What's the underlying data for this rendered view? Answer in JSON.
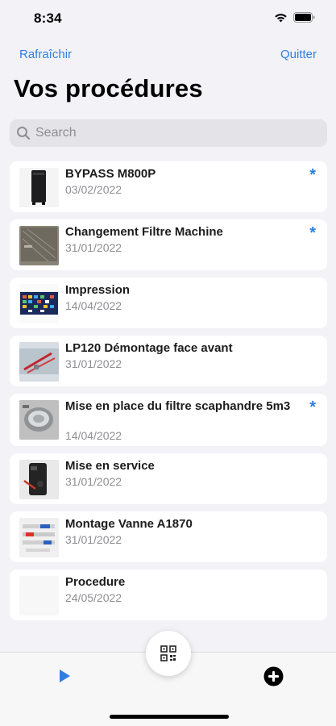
{
  "status_bar": {
    "time": "8:34"
  },
  "nav": {
    "left_label": "Rafraîchir",
    "right_label": "Quitter"
  },
  "title": "Vos procédures",
  "search": {
    "placeholder": "Search"
  },
  "procedures": [
    {
      "title": "BYPASS M800P",
      "date": "03/02/2022",
      "starred": true
    },
    {
      "title": "Changement Filtre Machine",
      "date": "31/01/2022",
      "starred": true
    },
    {
      "title": "Impression",
      "date": "14/04/2022",
      "starred": false
    },
    {
      "title": "LP120 Démontage face avant",
      "date": "31/01/2022",
      "starred": false
    },
    {
      "title": "Mise en place du filtre scaphandre 5m3",
      "date": "14/04/2022",
      "starred": true
    },
    {
      "title": "Mise en service",
      "date": "31/01/2022",
      "starred": false
    },
    {
      "title": "Montage Vanne A1870",
      "date": "31/01/2022",
      "starred": false
    },
    {
      "title": "Procedure",
      "date": "24/05/2022",
      "starred": false
    }
  ],
  "star_glyph": "*",
  "colors": {
    "accent": "#2f7fe0",
    "background": "#f2f2f7"
  },
  "tabbar": {
    "left_icon": "play-icon",
    "center_icon": "qr-code-icon",
    "right_icon": "add-circle-icon"
  }
}
